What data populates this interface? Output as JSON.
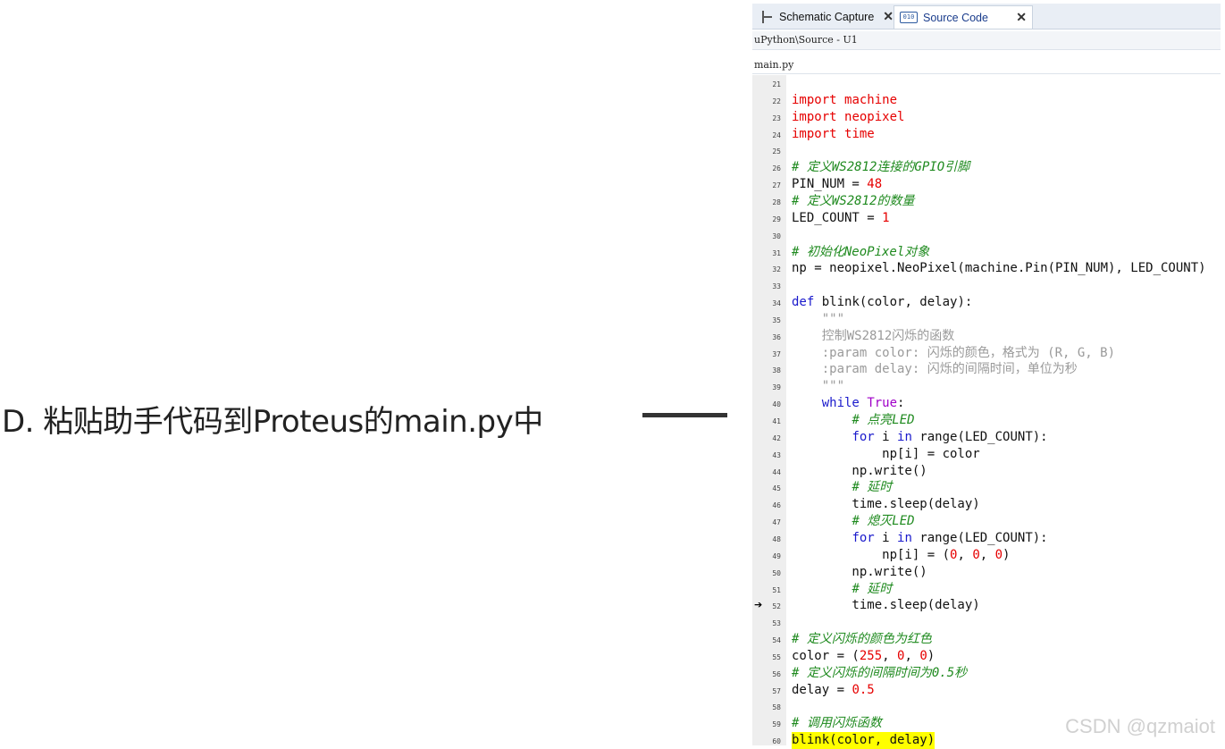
{
  "caption": "D. 粘贴助手代码到Proteus的main.py中",
  "tabs": [
    {
      "label": "Schematic Capture",
      "icon": "schematic-icon"
    },
    {
      "label": "Source Code",
      "icon": "source-code-icon"
    }
  ],
  "path": "uPython\\Source - U1",
  "file": "main.py",
  "watermark": "CSDN @qzmaiot",
  "colors": {
    "keyword": "#e60000",
    "comment": "#1f8a1f",
    "builtin": "#1a1acc",
    "highlight": "#ffff00"
  },
  "code_lines": [
    {
      "n": "21",
      "t": ""
    },
    {
      "n": "22",
      "t": "import machine"
    },
    {
      "n": "23",
      "t": "import neopixel"
    },
    {
      "n": "24",
      "t": "import time"
    },
    {
      "n": "25",
      "t": ""
    },
    {
      "n": "26",
      "t": "# 定义WS2812连接的GPIO引脚"
    },
    {
      "n": "27",
      "t": "PIN_NUM = 48"
    },
    {
      "n": "28",
      "t": "# 定义WS2812的数量"
    },
    {
      "n": "29",
      "t": "LED_COUNT = 1"
    },
    {
      "n": "30",
      "t": ""
    },
    {
      "n": "31",
      "t": "# 初始化NeoPixel对象"
    },
    {
      "n": "32",
      "t": "np = neopixel.NeoPixel(machine.Pin(PIN_NUM), LED_COUNT)"
    },
    {
      "n": "33",
      "t": ""
    },
    {
      "n": "34",
      "t": "def blink(color, delay):"
    },
    {
      "n": "35",
      "t": "    \"\"\""
    },
    {
      "n": "36",
      "t": "    控制WS2812闪烁的函数"
    },
    {
      "n": "37",
      "t": "    :param color: 闪烁的颜色，格式为 (R, G, B)"
    },
    {
      "n": "38",
      "t": "    :param delay: 闪烁的间隔时间，单位为秒"
    },
    {
      "n": "39",
      "t": "    \"\"\""
    },
    {
      "n": "40",
      "t": "    while True:"
    },
    {
      "n": "41",
      "t": "        # 点亮LED"
    },
    {
      "n": "42",
      "t": "        for i in range(LED_COUNT):"
    },
    {
      "n": "43",
      "t": "            np[i] = color"
    },
    {
      "n": "44",
      "t": "        np.write()"
    },
    {
      "n": "45",
      "t": "        # 延时"
    },
    {
      "n": "46",
      "t": "        time.sleep(delay)"
    },
    {
      "n": "47",
      "t": "        # 熄灭LED"
    },
    {
      "n": "48",
      "t": "        for i in range(LED_COUNT):"
    },
    {
      "n": "49",
      "t": "            np[i] = (0, 0, 0)"
    },
    {
      "n": "50",
      "t": "        np.write()"
    },
    {
      "n": "51",
      "t": "        # 延时"
    },
    {
      "n": "52",
      "t": "        time.sleep(delay)",
      "marker": "➔"
    },
    {
      "n": "53",
      "t": ""
    },
    {
      "n": "54",
      "t": "# 定义闪烁的颜色为红色"
    },
    {
      "n": "55",
      "t": "color = (255, 0, 0)"
    },
    {
      "n": "56",
      "t": "# 定义闪烁的间隔时间为0.5秒"
    },
    {
      "n": "57",
      "t": "delay = 0.5"
    },
    {
      "n": "58",
      "t": ""
    },
    {
      "n": "59",
      "t": "# 调用闪烁函数"
    },
    {
      "n": "60",
      "t": "blink(color, delay)",
      "highlight": true
    }
  ]
}
